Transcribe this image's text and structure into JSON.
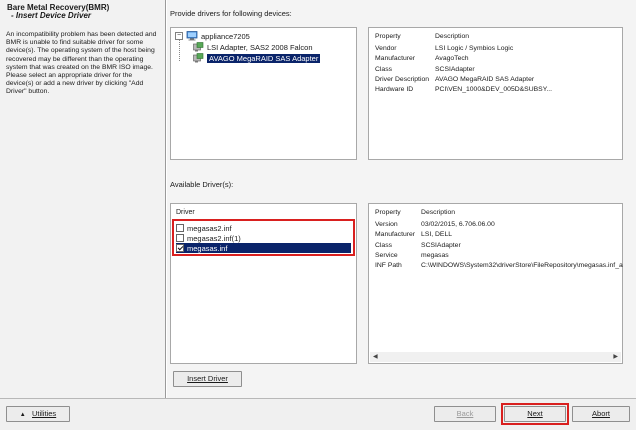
{
  "left_panel": {
    "app_title": "Bare Metal Recovery(BMR)",
    "step_title": "- Insert Device Driver",
    "description": "An incompatibility problem has been detected and BMR is unable to find suitable driver for some device(s). The operating system of the host being recovered may be different than the operating system that was created on the BMR ISO image. Please select an appropriate driver for the device(s) or add a new driver by clicking \"Add Driver\" button."
  },
  "devices": {
    "section_label": "Provide drivers for following devices:",
    "tree": {
      "root": "appliance7205",
      "children": [
        {
          "label": "LSI Adapter, SAS2 2008 Falcon",
          "selected": false
        },
        {
          "label": "AVAGO MegaRAID SAS Adapter",
          "selected": true
        }
      ]
    },
    "properties": {
      "header": [
        "Property",
        "Description"
      ],
      "rows": [
        [
          "Vendor",
          "LSI Logic / Symbios Logic"
        ],
        [
          "Manufacturer",
          "AvagoTech"
        ],
        [
          "Class",
          "SCSIAdapter"
        ],
        [
          "Driver Description",
          "AVAGO MegaRAID SAS Adapter"
        ],
        [
          "Hardware ID",
          "PCI\\VEN_1000&DEV_005D&SUBSY..."
        ]
      ]
    }
  },
  "drivers": {
    "section_label": "Available Driver(s):",
    "list_header": "Driver",
    "items": [
      {
        "name": "megasas2.inf",
        "checked": false,
        "selected": false
      },
      {
        "name": "megasas2.inf(1)",
        "checked": false,
        "selected": false
      },
      {
        "name": "megasas.inf",
        "checked": true,
        "selected": true
      }
    ],
    "properties": {
      "header": [
        "Property",
        "Description"
      ],
      "rows": [
        [
          "Version",
          "03/02/2015, 6.706.06.00"
        ],
        [
          "Manufacturer",
          "LSI, DELL"
        ],
        [
          "Class",
          "SCSIAdapter"
        ],
        [
          "Service",
          "megasas"
        ],
        [
          "INF Path",
          "C:\\WINDOWS\\System32\\driverStore\\FileRepository\\megasas.inf_a"
        ]
      ]
    },
    "insert_button": "Insert Driver"
  },
  "footer": {
    "utilities": "Utilities",
    "back": "Back",
    "next": "Next",
    "abort": "Abort"
  },
  "colors": {
    "selection": "#0a246a",
    "highlight": "#d9201f"
  }
}
